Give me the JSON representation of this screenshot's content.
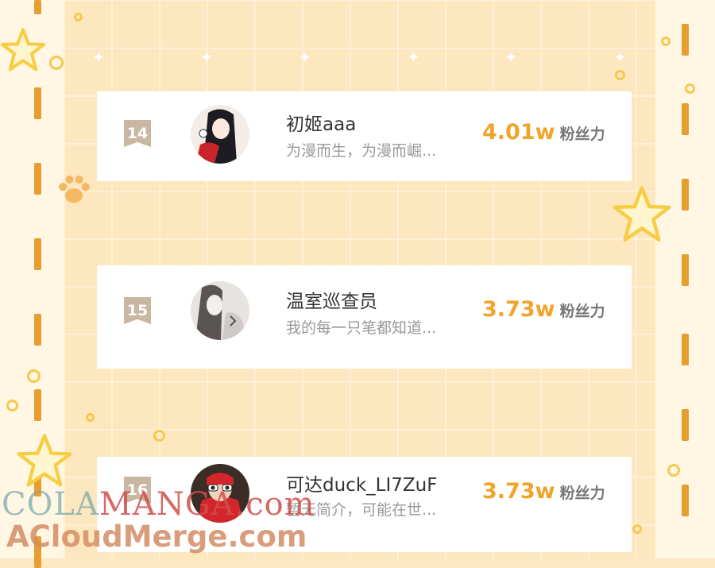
{
  "entries": [
    {
      "rank": "14",
      "name": "初姬aaa",
      "desc": "为漫而生，为漫而崛...",
      "fans": "4.01w",
      "fans_unit": "粉丝力"
    },
    {
      "rank": "15",
      "name": "温室巡查员",
      "desc": "我的每一只笔都知道...",
      "fans": "3.73w",
      "fans_unit": "粉丝力"
    },
    {
      "rank": "16",
      "name": "可达duck_LI7ZuF",
      "desc": "暂无简介，可能在世...",
      "fans": "3.73w",
      "fans_unit": "粉丝力"
    }
  ],
  "watermark": {
    "line1_a": "COLA",
    "line1_b": "MANGA",
    "line1_c": ".com",
    "line2": "ACloudMerge.com"
  },
  "colors": {
    "accent": "#f0a42a",
    "rank_badge": "#c9b7a2",
    "background": "#fde7bf",
    "dash": "#e59e2f"
  }
}
